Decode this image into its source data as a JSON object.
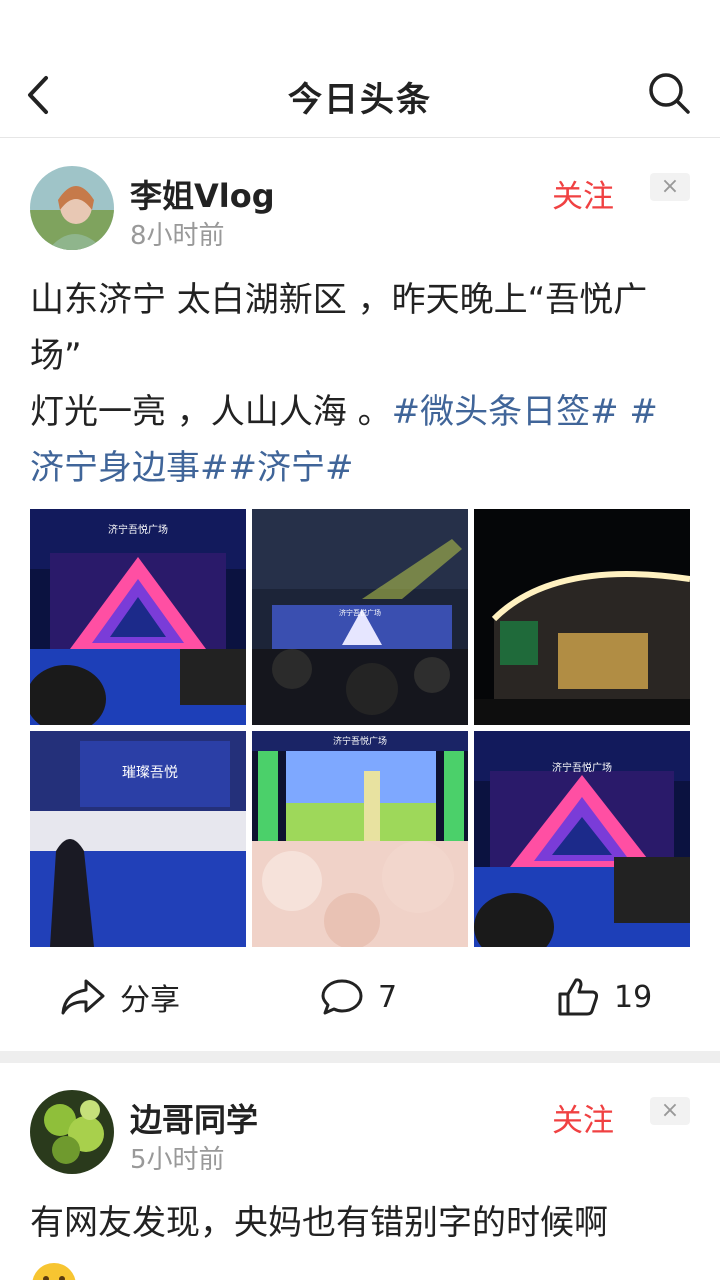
{
  "nav": {
    "title": "今日头条",
    "back_icon": "back-arrow-icon",
    "search_icon": "search-icon"
  },
  "posts": [
    {
      "author": "李姐Vlog",
      "time": "8小时前",
      "follow_label": "关注",
      "dismiss_label": "×",
      "text_line1": "山东济宁 太白湖新区 ，昨天晚上“吾悦广",
      "text_line2": "场”",
      "text_line3_plain": "灯光一亮 ，人山人海 。",
      "tag1": "#微头条日签# #",
      "tag2": "济宁身边事##济宁#",
      "photo_captions": [
        "济宁吾悦广场",
        "济宁吾悦广场",
        "",
        "璀璨吾悦",
        "济宁吾悦广场",
        "济宁吾悦广场"
      ],
      "share_label": "分享",
      "comment_count": "7",
      "like_count": "19"
    },
    {
      "author": "边哥同学",
      "time": "5小时前",
      "follow_label": "关注",
      "dismiss_label": "×",
      "text_line1": "有网友发现，央妈也有错别字的时候啊"
    }
  ],
  "colors": {
    "accent_red": "#f04142",
    "tag_blue": "#406599",
    "muted": "#999999"
  }
}
